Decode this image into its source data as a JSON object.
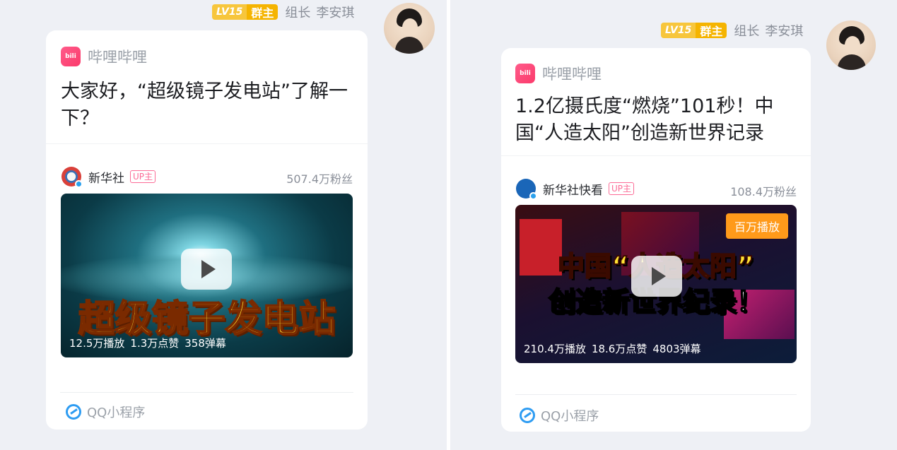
{
  "left": {
    "sender": {
      "level": "LV15",
      "role": "群主",
      "title": "组长",
      "name": "李安琪"
    },
    "card": {
      "app_name": "哔哩哔哩",
      "title": "大家好，“超级镜子发电站”了解一下？",
      "uploader": {
        "name": "新华社",
        "tag": "UP主",
        "fans": "507.4万粉丝"
      },
      "thumbnail": {
        "overlay_text": "超级镜子发电站",
        "plays": "12.5万播放",
        "likes": "1.3万点赞",
        "danmaku": "358弹幕"
      },
      "footer": "QQ小程序"
    }
  },
  "right": {
    "sender": {
      "level": "LV15",
      "role": "群主",
      "title": "组长",
      "name": "李安琪"
    },
    "card": {
      "app_name": "哔哩哔哩",
      "title": "1.2亿摄氏度“燃烧”101秒！中国“人造太阳”创造新世界记录",
      "uploader": {
        "name": "新华社快看",
        "tag": "UP主",
        "fans": "108.4万粉丝"
      },
      "thumbnail": {
        "badge": "百万播放",
        "overlay_line1": "中国“人造太阳”",
        "overlay_line2": "创造新世界纪录！",
        "plays": "210.4万播放",
        "likes": "18.6万点赞",
        "danmaku": "4803弹幕"
      },
      "footer": "QQ小程序"
    }
  },
  "colors": {
    "accent_pink": "#fb6b96",
    "badge_orange": "#ff9a1a",
    "level_yellow": "#f5b400",
    "qq_blue": "#2e9cf2"
  }
}
